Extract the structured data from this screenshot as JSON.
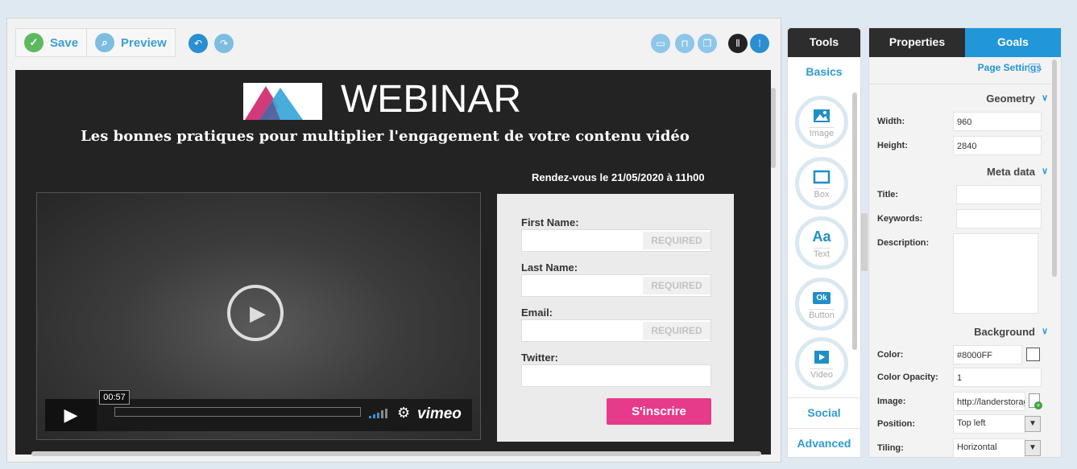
{
  "toolbar": {
    "save_label": "Save",
    "preview_label": "Preview"
  },
  "canvas": {
    "title": "WEBINAR",
    "subtitle": "Les bonnes pratiques pour multiplier l'engagement de votre contenu vidéo",
    "date_line": "Rendez-vous le 21/05/2020 à 11h00",
    "video": {
      "time": "00:57",
      "brand": "vimeo"
    },
    "form": {
      "fields": [
        {
          "label": "First Name:",
          "required": "REQUIRED"
        },
        {
          "label": "Last Name:",
          "required": "REQUIRED"
        },
        {
          "label": "Email:",
          "required": "REQUIRED"
        },
        {
          "label": "Twitter:",
          "required": ""
        }
      ],
      "submit": "S'inscrire",
      "submit_color": "#E63B8A"
    }
  },
  "tools": {
    "header": "Tools",
    "basics": "Basics",
    "items": [
      {
        "label": "Image",
        "icon": "image-icon"
      },
      {
        "label": "Box",
        "icon": "box-icon"
      },
      {
        "label": "Text",
        "icon": "text-icon",
        "glyph": "Aa"
      },
      {
        "label": "Button",
        "icon": "button-icon",
        "glyph": "Ok"
      },
      {
        "label": "Video",
        "icon": "video-icon"
      }
    ],
    "social": "Social",
    "advanced": "Advanced"
  },
  "properties": {
    "tab_properties": "Properties",
    "tab_goals": "Goals",
    "page_settings": "Page Settings",
    "geometry": "Geometry",
    "width_label": "Width:",
    "width_value": "960",
    "height_label": "Height:",
    "height_value": "2840",
    "meta": "Meta data",
    "title_label": "Title:",
    "keywords_label": "Keywords:",
    "description_label": "Description:",
    "background": "Background",
    "color_label": "Color:",
    "color_value": "#8000FF",
    "opacity_label": "Color Opacity:",
    "opacity_value": "1",
    "image_label": "Image:",
    "image_value": "http://landerstorage",
    "position_label": "Position:",
    "position_value": "Top left",
    "tiling_label": "Tiling:",
    "tiling_value": "Horizontal"
  },
  "colors": {
    "accent": "#2196D9",
    "dark_header": "#2D2D2D",
    "save_green": "#5DB95D"
  }
}
